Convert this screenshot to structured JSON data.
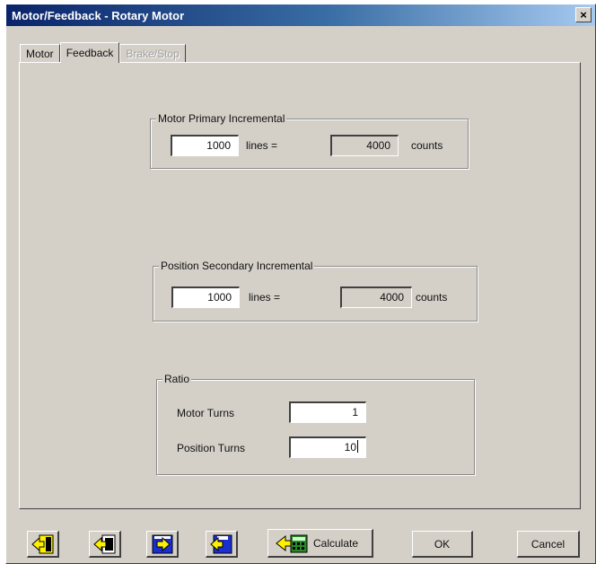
{
  "window": {
    "title": "Motor/Feedback - Rotary Motor",
    "close_label": "×"
  },
  "tabs": [
    {
      "label": "Motor",
      "state": "normal"
    },
    {
      "label": "Feedback",
      "state": "active"
    },
    {
      "label": "Brake/Stop",
      "state": "disabled"
    }
  ],
  "motor_primary": {
    "legend": "Motor Primary Incremental",
    "lines_value": "1000",
    "lines_label": "lines =",
    "counts_value": "4000",
    "counts_label": "counts"
  },
  "position_secondary": {
    "legend": "Position Secondary Incremental",
    "lines_value": "1000",
    "lines_label": "lines =",
    "counts_value": "4000",
    "counts_label": "counts"
  },
  "ratio": {
    "legend": "Ratio",
    "motor_turns_label": "Motor Turns",
    "motor_turns_value": "1",
    "position_turns_label": "Position Turns",
    "position_turns_value": "10"
  },
  "toolbar": {
    "icons": [
      "load-from-drive-icon",
      "load-from-file-icon",
      "save-to-drive-icon",
      "save-to-file-icon"
    ],
    "calculate_label": "Calculate",
    "ok_label": "OK",
    "cancel_label": "Cancel"
  },
  "colors": {
    "titlebar_start": "#0a246a",
    "titlebar_end": "#a6caf0",
    "face": "#d4d0c8",
    "icon_yellow": "#ffef00",
    "icon_blue": "#1a2fd0"
  }
}
